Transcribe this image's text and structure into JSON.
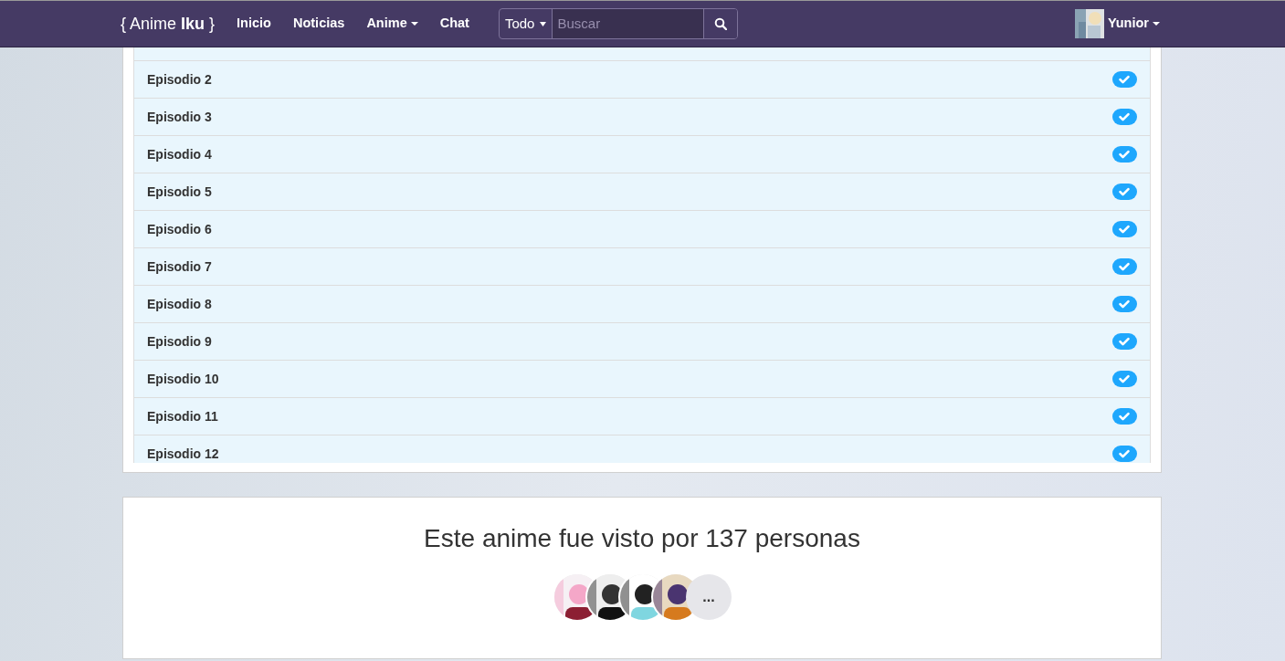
{
  "navbar": {
    "brand_prefix": "{ Anime ",
    "brand_bold": "Iku",
    "brand_suffix": " }",
    "links": [
      {
        "label": "Inicio",
        "dropdown": false
      },
      {
        "label": "Noticias",
        "dropdown": false
      },
      {
        "label": "Anime",
        "dropdown": true
      },
      {
        "label": "Chat",
        "dropdown": false
      }
    ],
    "search": {
      "scope": "Todo",
      "placeholder": "Buscar"
    },
    "user": {
      "name": "Yunior"
    }
  },
  "episodes": [
    {
      "title": "Episodio 2",
      "watched": true
    },
    {
      "title": "Episodio 3",
      "watched": true
    },
    {
      "title": "Episodio 4",
      "watched": true
    },
    {
      "title": "Episodio 5",
      "watched": true
    },
    {
      "title": "Episodio 6",
      "watched": true
    },
    {
      "title": "Episodio 7",
      "watched": true
    },
    {
      "title": "Episodio 8",
      "watched": true
    },
    {
      "title": "Episodio 9",
      "watched": true
    },
    {
      "title": "Episodio 10",
      "watched": true
    },
    {
      "title": "Episodio 11",
      "watched": true
    },
    {
      "title": "Episodio 12",
      "watched": true
    }
  ],
  "viewers": {
    "title": "Este anime fue visto por 137 personas",
    "more": "..."
  }
}
